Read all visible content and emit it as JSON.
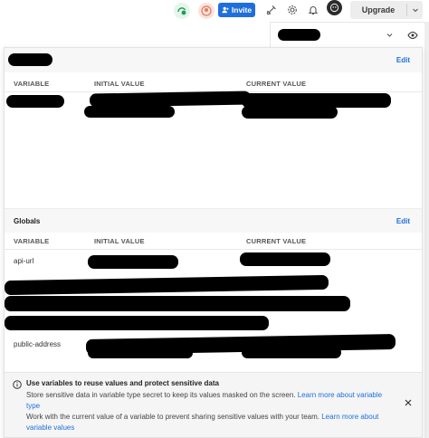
{
  "topbar": {
    "invite_label": "Invite",
    "upgrade_label": "Upgrade",
    "icons": [
      "sync-status-icon",
      "collaborator-avatar-icon",
      "person-plus-icon",
      "satellite-icon",
      "gear-icon",
      "bell-icon",
      "profile-avatar-icon",
      "chevron-down-icon"
    ]
  },
  "environment": {
    "icons": [
      "chevron-down-icon",
      "eye-icon"
    ]
  },
  "env_section": {
    "edit_label": "Edit",
    "columns": [
      "VARIABLE",
      "INITIAL VALUE",
      "CURRENT VALUE"
    ]
  },
  "globals": {
    "title": "Globals",
    "edit_label": "Edit",
    "columns": [
      "VARIABLE",
      "INITIAL VALUE",
      "CURRENT VALUE"
    ],
    "rows": [
      {
        "variable": "api-url"
      },
      {
        "variable": "public-address"
      }
    ]
  },
  "info": {
    "title": "Use variables to reuse values and protect sensitive data",
    "line1_text": "Store sensitive data in variable type secret to keep its values masked on the screen. ",
    "line1_link_a": "Learn more about variable",
    "line1_link_b": "type",
    "line2_text": "Work with the current value of a variable to prevent sharing sensitive values with your team. ",
    "line2_link_a": "Learn more about",
    "line2_link_b": "variable values"
  },
  "colors": {
    "accent": "#1f6fdb",
    "redaction": "#000000"
  }
}
